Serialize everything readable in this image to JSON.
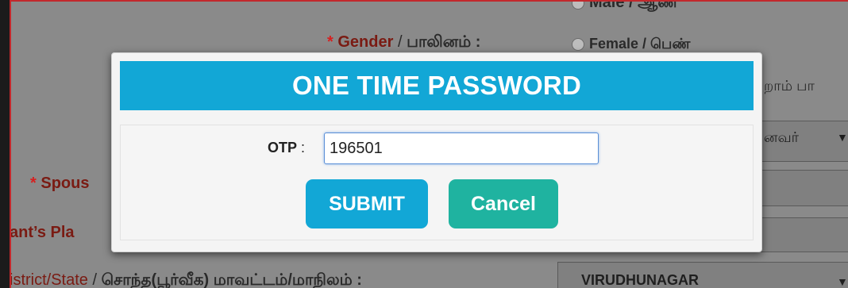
{
  "form": {
    "gender_options": [
      {
        "label": "Male / ஆண்"
      },
      {
        "label": "Female / பெண்"
      }
    ],
    "gender_field": {
      "required_mark": "*",
      "label_en": "Gender",
      "separator": " / ",
      "label_ta": "பாலினம் :"
    },
    "partial_third_gender": "றாம் பா",
    "spouse_field": {
      "required_mark": "*",
      "label_en": "Spous"
    },
    "spouse_select_partial": "னவர்",
    "applicant_place_partial": "ant’s Pla",
    "district_field": {
      "label_en": "istrict/State",
      "separator": " / ",
      "label_ta": "சொந்த(பூர்வீக) மாவட்டம்/மாநிலம் :"
    },
    "district_value": "VIRUDHUNAGAR"
  },
  "dialog": {
    "title": "ONE TIME PASSWORD",
    "otp_label": "OTP",
    "otp_colon": " :",
    "otp_value": "196501",
    "submit_label": "SUBMIT",
    "cancel_label": "Cancel"
  },
  "colors": {
    "header": "#12a7d6",
    "submit": "#12a7d6",
    "cancel": "#1fb3a0",
    "label_text": "#7a1b13",
    "required": "#d62020"
  },
  "icons": [
    "radio-button-icon",
    "dropdown-arrow-icon"
  ]
}
